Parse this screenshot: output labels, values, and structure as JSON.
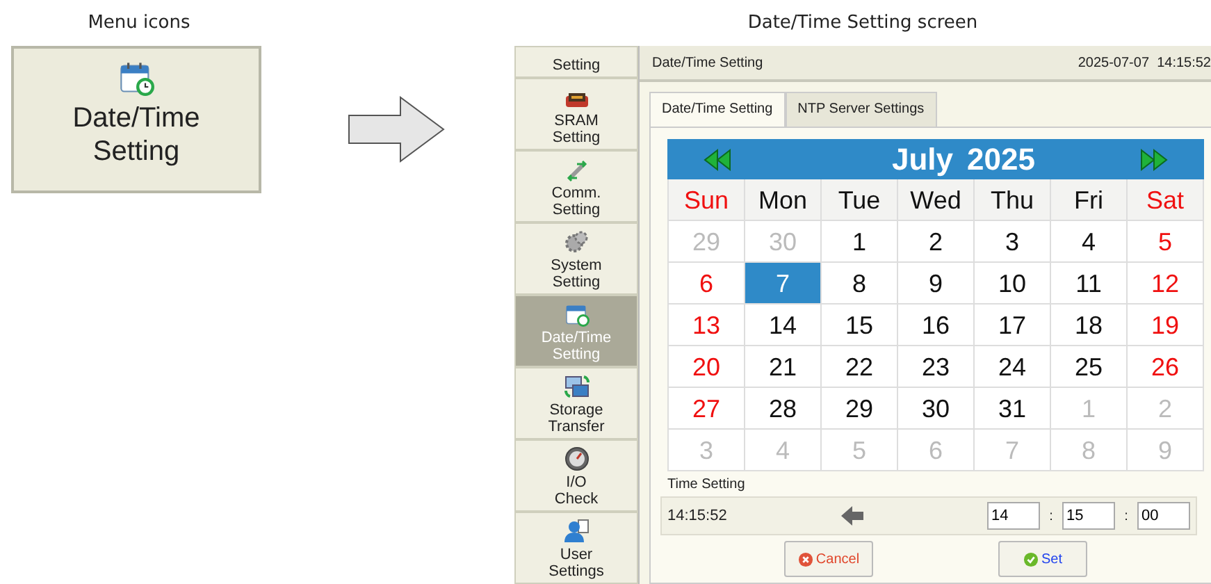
{
  "captions": {
    "left": "Menu icons",
    "right": "Date/Time Setting screen"
  },
  "menu_tile": {
    "lines": [
      "Date/Time",
      "Setting"
    ]
  },
  "sidebar": {
    "items": [
      {
        "lines": [
          "Setting"
        ],
        "kind": "partial",
        "selected": false
      },
      {
        "lines": [
          "SRAM",
          "Setting"
        ],
        "kind": "chip",
        "selected": false
      },
      {
        "lines": [
          "Comm.",
          "Setting"
        ],
        "kind": "comm",
        "selected": false
      },
      {
        "lines": [
          "System",
          "Setting"
        ],
        "kind": "gear",
        "selected": false
      },
      {
        "lines": [
          "Date/Time",
          "Setting"
        ],
        "kind": "calendar",
        "selected": true
      },
      {
        "lines": [
          "Storage",
          "Transfer"
        ],
        "kind": "storage",
        "selected": false
      },
      {
        "lines": [
          "I/O",
          "Check"
        ],
        "kind": "gauge",
        "selected": false
      },
      {
        "lines": [
          "User",
          "Settings"
        ],
        "kind": "user",
        "selected": false
      }
    ]
  },
  "header": {
    "title": "Date/Time Setting",
    "datetime": "2025-07-07  14:15:52"
  },
  "tabs": [
    {
      "label": "Date/Time Setting",
      "selected": true
    },
    {
      "label": "NTP Server Settings",
      "selected": false
    }
  ],
  "calendar": {
    "month": "July",
    "year": "2025",
    "weekdays": [
      {
        "label": "Sun",
        "weekend": true
      },
      {
        "label": "Mon",
        "weekend": false
      },
      {
        "label": "Tue",
        "weekend": false
      },
      {
        "label": "Wed",
        "weekend": false
      },
      {
        "label": "Thu",
        "weekend": false
      },
      {
        "label": "Fri",
        "weekend": false
      },
      {
        "label": "Sat",
        "weekend": true
      }
    ],
    "weeks": [
      [
        {
          "day": "29",
          "in_month": false,
          "selected": false
        },
        {
          "day": "30",
          "in_month": false,
          "selected": false
        },
        {
          "day": "1",
          "in_month": true,
          "selected": false
        },
        {
          "day": "2",
          "in_month": true,
          "selected": false
        },
        {
          "day": "3",
          "in_month": true,
          "selected": false
        },
        {
          "day": "4",
          "in_month": true,
          "selected": false
        },
        {
          "day": "5",
          "in_month": true,
          "selected": false
        }
      ],
      [
        {
          "day": "6",
          "in_month": true,
          "selected": false
        },
        {
          "day": "7",
          "in_month": true,
          "selected": true
        },
        {
          "day": "8",
          "in_month": true,
          "selected": false
        },
        {
          "day": "9",
          "in_month": true,
          "selected": false
        },
        {
          "day": "10",
          "in_month": true,
          "selected": false
        },
        {
          "day": "11",
          "in_month": true,
          "selected": false
        },
        {
          "day": "12",
          "in_month": true,
          "selected": false
        }
      ],
      [
        {
          "day": "13",
          "in_month": true,
          "selected": false
        },
        {
          "day": "14",
          "in_month": true,
          "selected": false
        },
        {
          "day": "15",
          "in_month": true,
          "selected": false
        },
        {
          "day": "16",
          "in_month": true,
          "selected": false
        },
        {
          "day": "17",
          "in_month": true,
          "selected": false
        },
        {
          "day": "18",
          "in_month": true,
          "selected": false
        },
        {
          "day": "19",
          "in_month": true,
          "selected": false
        }
      ],
      [
        {
          "day": "20",
          "in_month": true,
          "selected": false
        },
        {
          "day": "21",
          "in_month": true,
          "selected": false
        },
        {
          "day": "22",
          "in_month": true,
          "selected": false
        },
        {
          "day": "23",
          "in_month": true,
          "selected": false
        },
        {
          "day": "24",
          "in_month": true,
          "selected": false
        },
        {
          "day": "25",
          "in_month": true,
          "selected": false
        },
        {
          "day": "26",
          "in_month": true,
          "selected": false
        }
      ],
      [
        {
          "day": "27",
          "in_month": true,
          "selected": false
        },
        {
          "day": "28",
          "in_month": true,
          "selected": false
        },
        {
          "day": "29",
          "in_month": true,
          "selected": false
        },
        {
          "day": "30",
          "in_month": true,
          "selected": false
        },
        {
          "day": "31",
          "in_month": true,
          "selected": false
        },
        {
          "day": "1",
          "in_month": false,
          "selected": false
        },
        {
          "day": "2",
          "in_month": false,
          "selected": false
        }
      ],
      [
        {
          "day": "3",
          "in_month": false,
          "selected": false
        },
        {
          "day": "4",
          "in_month": false,
          "selected": false
        },
        {
          "day": "5",
          "in_month": false,
          "selected": false
        },
        {
          "day": "6",
          "in_month": false,
          "selected": false
        },
        {
          "day": "7",
          "in_month": false,
          "selected": false
        },
        {
          "day": "8",
          "in_month": false,
          "selected": false
        },
        {
          "day": "9",
          "in_month": false,
          "selected": false
        }
      ]
    ]
  },
  "time_setting": {
    "label": "Time Setting",
    "current": "14:15:52",
    "hour": "14",
    "minute": "15",
    "second": "00",
    "separators": [
      ":",
      ":"
    ]
  },
  "buttons": [
    {
      "label": "Cancel",
      "kind": "cancel"
    },
    {
      "label": "Set",
      "kind": "set"
    }
  ]
}
